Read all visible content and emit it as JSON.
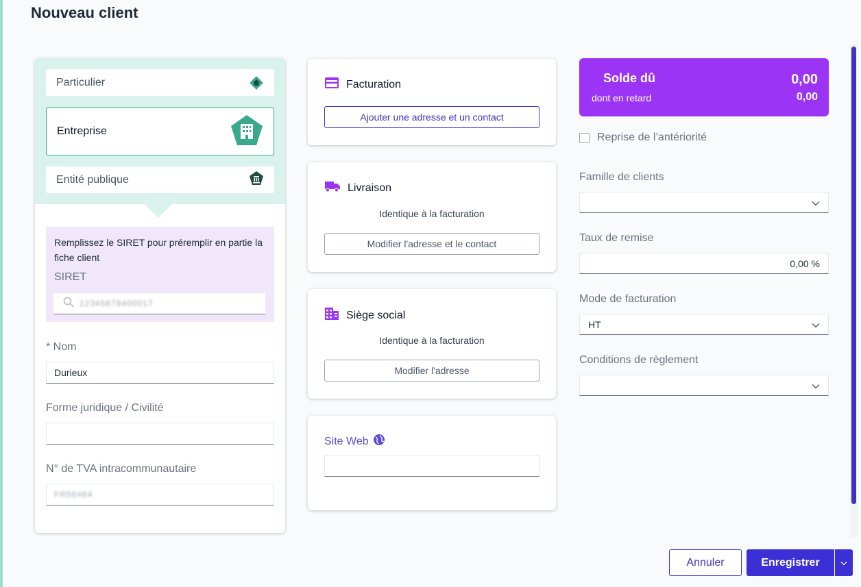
{
  "page": {
    "title": "Nouveau client"
  },
  "client_type": {
    "options": [
      {
        "label": "Particulier",
        "icon": "house-icon"
      },
      {
        "label": "Entreprise",
        "icon": "building-icon",
        "selected": true
      },
      {
        "label": "Entité publique",
        "icon": "public-building-icon"
      }
    ]
  },
  "siret": {
    "help_text": "Remplissez le SIRET pour préremplir en partie la fiche client",
    "label": "SIRET",
    "value": "12345678400017"
  },
  "nom": {
    "label": "* Nom",
    "value": "Durieux"
  },
  "forme_juridique": {
    "label": "Forme juridique / Civilité",
    "value": ""
  },
  "tva": {
    "label": "N° de TVA intracommunautaire",
    "value": "FR56464"
  },
  "facturation": {
    "title": "Facturation",
    "button": "Ajouter une adresse et un contact"
  },
  "livraison": {
    "title": "Livraison",
    "subtitle": "Identique à la facturation",
    "button": "Modifier l'adresse et le contact"
  },
  "siege_social": {
    "title": "Siège social",
    "subtitle": "Identique à la facturation",
    "button": "Modifier l'adresse"
  },
  "site_web": {
    "title": "Site Web",
    "value": ""
  },
  "solde": {
    "title": "Solde dû",
    "value": "0,00",
    "late_label": "dont en retard",
    "late_value": "0,00"
  },
  "anteriorite": {
    "label": "Reprise de l’antériorité",
    "checked": false
  },
  "famille_clients": {
    "label": "Famille de clients",
    "value": ""
  },
  "taux_remise": {
    "label": "Taux de remise",
    "value": "0,00 %"
  },
  "mode_facturation": {
    "label": "Mode de facturation",
    "value": "HT"
  },
  "conditions_reglement": {
    "label": "Conditions de règlement",
    "value": ""
  },
  "actions": {
    "cancel": "Annuler",
    "save": "Enregistrer"
  },
  "colors": {
    "accent": "#3b2fd6",
    "solde_bg": "#9b34f5",
    "type_bg": "#d9f2ec",
    "selected_border": "#3aa88a",
    "siret_bg": "#f0e7fb",
    "icon_purple": "#9b34f5"
  }
}
